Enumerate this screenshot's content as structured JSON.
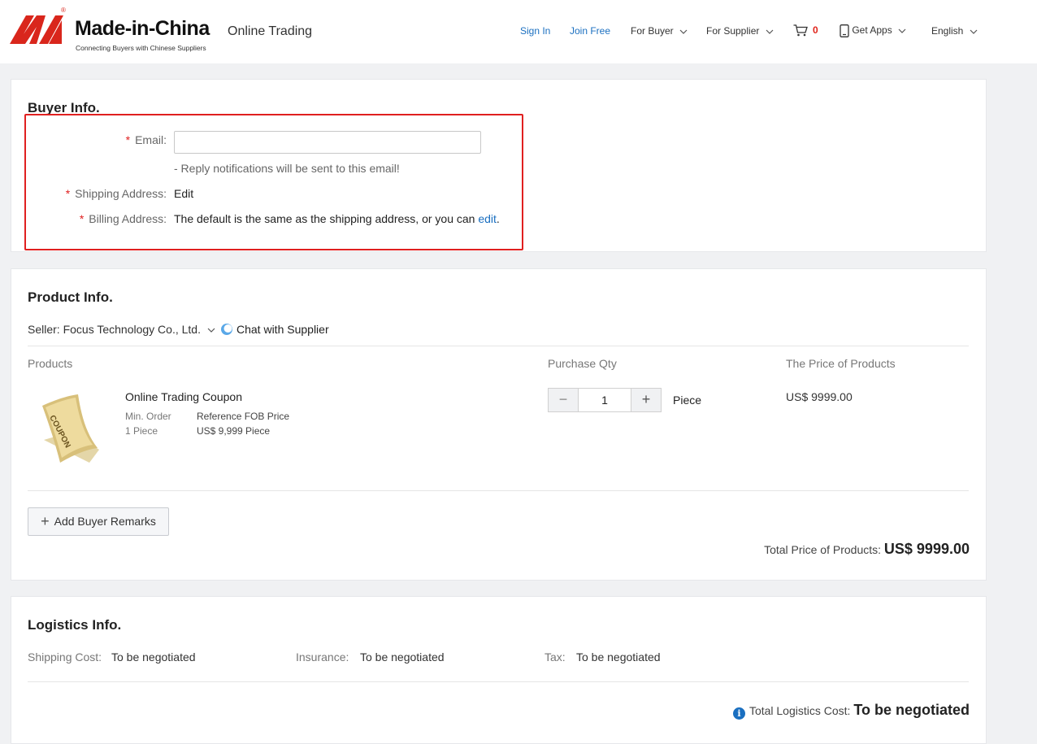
{
  "header": {
    "logo_text": "Made-in-China",
    "logo_tagline": "Connecting Buyers with Chinese Suppliers",
    "subtitle": "Online Trading",
    "nav": {
      "sign_in": "Sign In",
      "join_free": "Join Free",
      "for_buyer": "For Buyer",
      "for_supplier": "For Supplier",
      "cart_count": "0",
      "get_apps": "Get Apps",
      "language": "English"
    },
    "icons": [
      "cart-icon",
      "phone-icon",
      "chevron-down-icon"
    ]
  },
  "buyer": {
    "title": "Buyer Info.",
    "email_label": "Email:",
    "email_value": "",
    "email_hint": "- Reply notifications will be sent to this email!",
    "shipping_label": "Shipping Address:",
    "shipping_edit": "Edit",
    "billing_label": "Billing Address:",
    "billing_text": "The default is the same as the shipping address, or you can",
    "billing_edit": "edit",
    "billing_period": "."
  },
  "product": {
    "title": "Product Info.",
    "seller": "Seller: Focus Technology Co., Ltd.",
    "chat": "Chat with Supplier",
    "col_products": "Products",
    "col_qty": "Purchase Qty",
    "col_price": "The Price of Products",
    "item_name": "Online Trading Coupon",
    "min_order_label": "Min. Order",
    "min_order_value": "1 Piece",
    "ref_price_label": "Reference FOB Price",
    "ref_price_value": "US$ 9,999 Piece",
    "image_text": "COUPON",
    "qty_minus": "−",
    "qty": "1",
    "qty_plus": "+",
    "unit": "Piece",
    "price": "US$ 9999.00",
    "remark_button": "Add Buyer Remarks",
    "total_label": "Total Price of Products:",
    "total_value": "US$ 9999.00"
  },
  "logistics": {
    "title": "Logistics Info.",
    "shipping_label": "Shipping Cost:",
    "shipping_value": "To be negotiated",
    "insurance_label": "Insurance:",
    "insurance_value": "To be negotiated",
    "tax_label": "Tax:",
    "tax_value": "To be negotiated",
    "total_label": "Total Logistics Cost:",
    "total_value": "To be negotiated"
  },
  "colors": {
    "brand_red": "#e0231a",
    "link_blue": "#1a6fc0",
    "highlight": "#e02020"
  }
}
